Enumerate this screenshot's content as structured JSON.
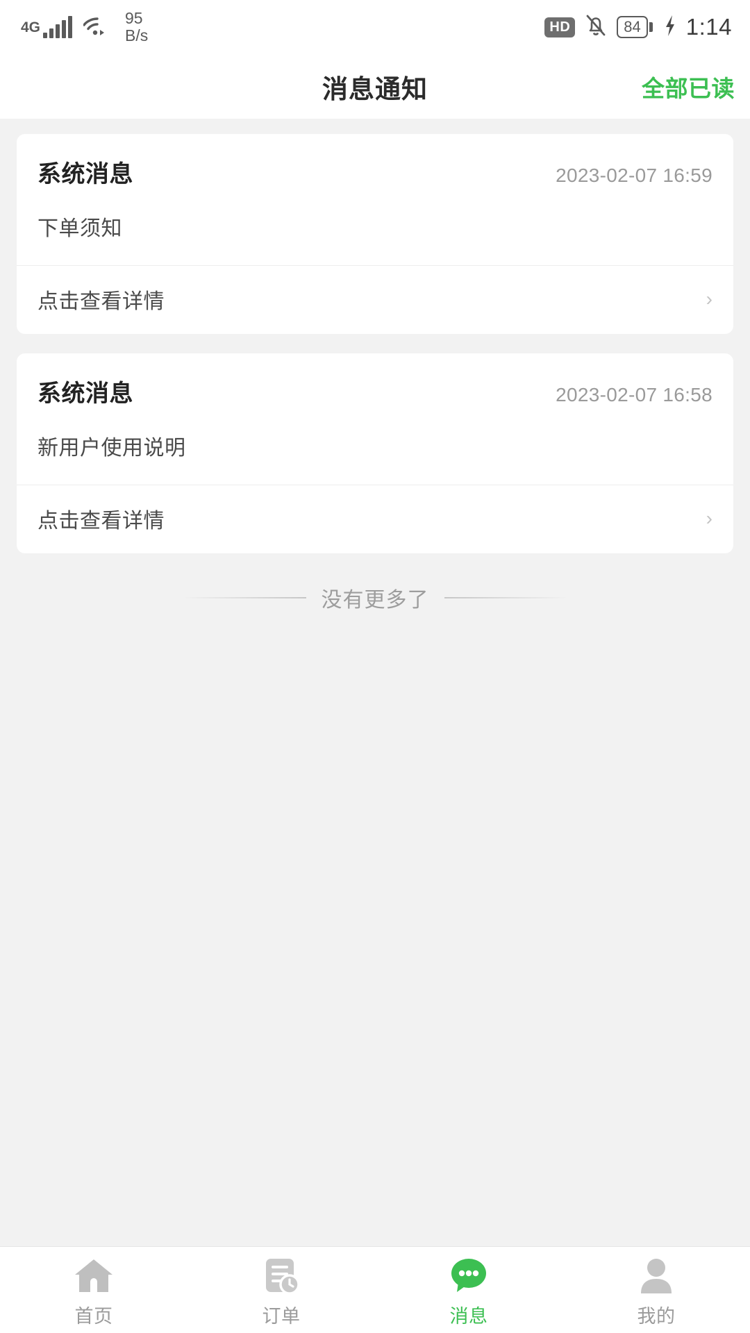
{
  "status_bar": {
    "network_type": "4G",
    "signal_icon": "signal-bars-icon",
    "wifi_icon": "wifi-icon",
    "network_speed_value": "95",
    "network_speed_unit": "B/s",
    "hd_badge": "HD",
    "mute_icon": "bell-muted-icon",
    "battery_level": "84",
    "charging_icon": "charging-bolt-icon",
    "time": "1:14"
  },
  "header": {
    "title": "消息通知",
    "action_label": "全部已读"
  },
  "messages": [
    {
      "title": "系统消息",
      "time": "2023-02-07 16:59",
      "body": "下单须知",
      "footer_label": "点击查看详情",
      "chevron": "›"
    },
    {
      "title": "系统消息",
      "time": "2023-02-07 16:58",
      "body": "新用户使用说明",
      "footer_label": "点击查看详情",
      "chevron": "›"
    }
  ],
  "list_end": {
    "text": "没有更多了"
  },
  "tabbar": {
    "items": [
      {
        "label": "首页",
        "icon": "home-icon",
        "active": false
      },
      {
        "label": "订单",
        "icon": "order-doc-clock-icon",
        "active": false
      },
      {
        "label": "消息",
        "icon": "message-bubble-icon",
        "active": true
      },
      {
        "label": "我的",
        "icon": "person-icon",
        "active": false
      }
    ]
  },
  "colors": {
    "accent_green": "#3cbf52",
    "page_background": "#f2f2f2",
    "card_background": "#ffffff",
    "muted_text": "#9a9a9a"
  }
}
